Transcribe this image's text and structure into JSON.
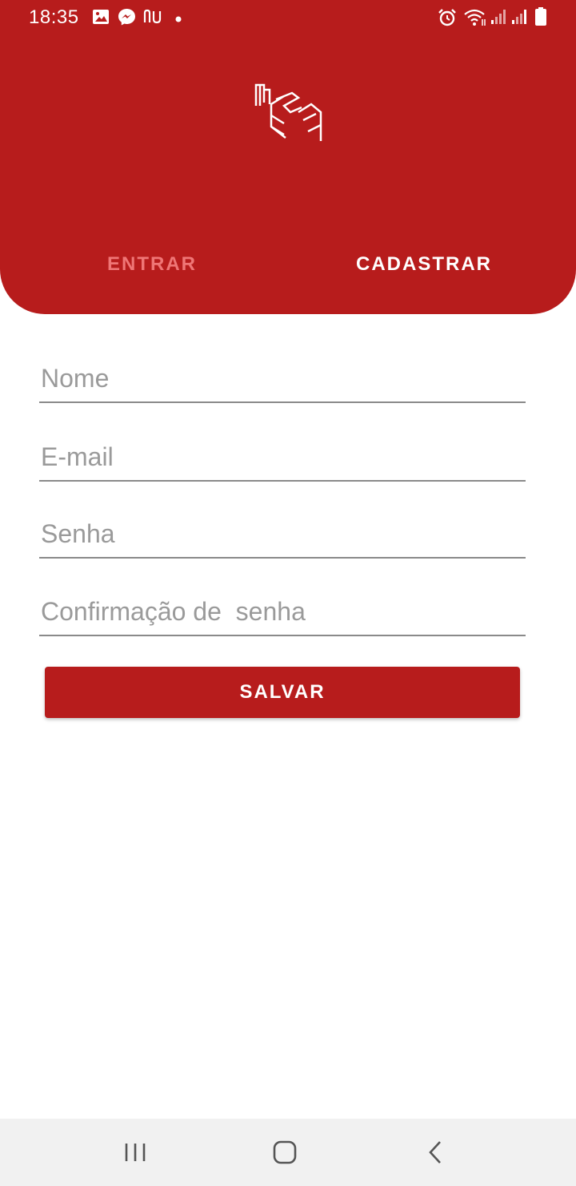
{
  "status_bar": {
    "time": "18:35",
    "left_icons": [
      "gallery-icon",
      "messenger-icon",
      "nubank-icon",
      "notification-dot-icon"
    ],
    "right_icons": [
      "alarm-icon",
      "wifi-icon",
      "signal-icon",
      "signal-icon",
      "battery-icon"
    ]
  },
  "header": {
    "background_color": "#b71c1c",
    "logo": "app-logo-icon",
    "tabs": [
      {
        "label": "ENTRAR",
        "active": false,
        "color": "#ef7676"
      },
      {
        "label": "CADASTRAR",
        "active": true,
        "color": "#ffffff"
      }
    ]
  },
  "form": {
    "name_placeholder": "Nome",
    "email_placeholder": "E-mail",
    "password_placeholder": "Senha",
    "confirm_placeholder": "Confirmação de  senha",
    "save_label": "SALVAR"
  },
  "nav_bar": {
    "buttons": [
      "recent-apps-icon",
      "home-icon",
      "back-icon"
    ]
  }
}
